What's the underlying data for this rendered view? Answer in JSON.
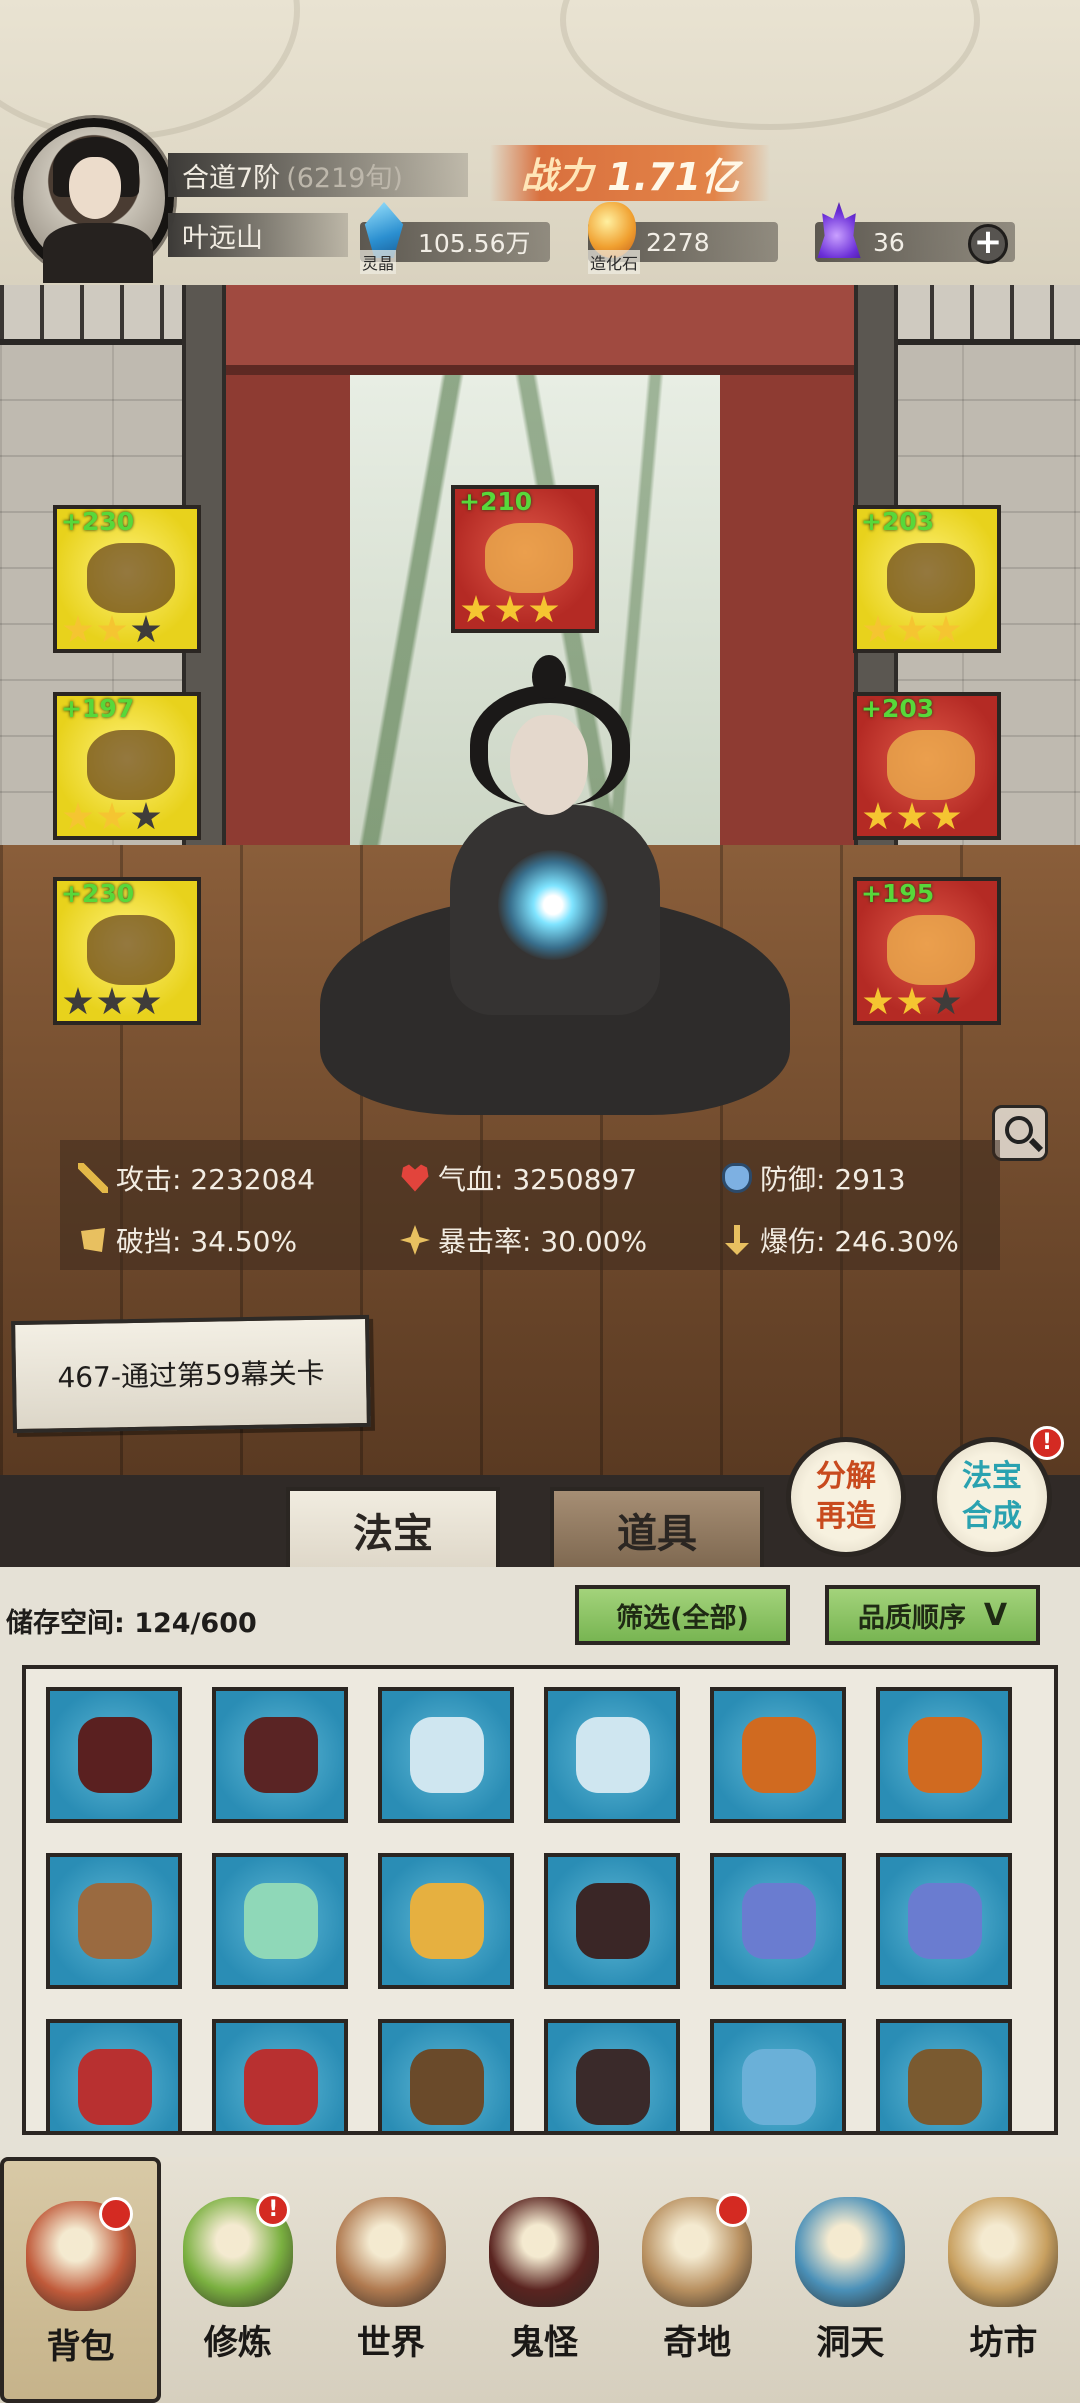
{
  "header": {
    "realm": "合道7阶",
    "realm_sub": "(6219旬)",
    "player_name": "叶远山",
    "combat_power_label": "战力",
    "combat_power_value": "1.71亿",
    "resources": [
      {
        "caption": "灵晶",
        "value": "105.56万",
        "icon": "spirit-crystal-icon"
      },
      {
        "caption": "造化石",
        "value": "2278",
        "icon": "creation-stone-icon"
      },
      {
        "caption": "",
        "value": "36",
        "icon": "purple-flame-icon"
      }
    ],
    "add_label": "+"
  },
  "equipment": [
    {
      "slot": "weapon",
      "bonus": "+230",
      "stars": 2,
      "color": "yellow"
    },
    {
      "slot": "crown",
      "bonus": "+210",
      "stars": 3,
      "color": "red"
    },
    {
      "slot": "headband",
      "bonus": "+203",
      "stars": 3,
      "color": "yellow"
    },
    {
      "slot": "robe",
      "bonus": "+197",
      "stars": 2,
      "color": "yellow"
    },
    {
      "slot": "necklace",
      "bonus": "+203",
      "stars": 3,
      "color": "red"
    },
    {
      "slot": "boots",
      "bonus": "+230",
      "stars": 0,
      "color": "yellow"
    },
    {
      "slot": "ring",
      "bonus": "+195",
      "stars": 2,
      "color": "red"
    }
  ],
  "stats": {
    "attack": "攻击: 2232084",
    "hp": "气血: 3250897",
    "defense": "防御: 2913",
    "break_block": "破挡: 34.50%",
    "crit_rate": "暴击率: 30.00%",
    "crit_damage": "爆伤: 246.30%"
  },
  "quest": "467-通过第59幕关卡",
  "tabs": {
    "treasure": "法宝",
    "items": "道具"
  },
  "round_buttons": {
    "decompose": "分解\n再造",
    "compose": "法宝\n合成",
    "badge": "!"
  },
  "inventory": {
    "storage": "储存空间: 124/600",
    "filter_label": "筛选(全部)",
    "sort_label": "品质顺序",
    "sort_chevron": "V",
    "items": [
      {
        "icon": "dark-claw-icon",
        "color": "#5a2020"
      },
      {
        "icon": "spiked-wheel-icon",
        "color": "#5a2424"
      },
      {
        "icon": "ice-sword-icon",
        "color": "#cfe6f0"
      },
      {
        "icon": "ice-sword-icon",
        "color": "#cfe6f0"
      },
      {
        "icon": "flame-axe-icon",
        "color": "#d06a20"
      },
      {
        "icon": "flame-axe-icon",
        "color": "#d06a20"
      },
      {
        "icon": "bronze-staff-icon",
        "color": "#9a6a40"
      },
      {
        "icon": "jade-mirror-icon",
        "color": "#8fd8b8"
      },
      {
        "icon": "golden-beast-icon",
        "color": "#e6b040"
      },
      {
        "icon": "dark-robe-icon",
        "color": "#3a2626"
      },
      {
        "icon": "blue-fish-icon",
        "color": "#6a7cd0"
      },
      {
        "icon": "blue-fish-icon",
        "color": "#6a7cd0"
      },
      {
        "icon": "demon-mask-icon",
        "color": "#b83030"
      },
      {
        "icon": "demon-mask-icon",
        "color": "#b83030"
      },
      {
        "icon": "leather-armor-icon",
        "color": "#6a4a2a"
      },
      {
        "icon": "crimson-gauntlet-icon",
        "color": "#3a2a2a"
      },
      {
        "icon": "crystal-dragon-icon",
        "color": "#6ab0d8"
      },
      {
        "icon": "wooden-horn-icon",
        "color": "#7a5a30"
      }
    ]
  },
  "nav": [
    {
      "label": "背包",
      "icon": "bag-icon",
      "color": "#c05a3a",
      "badge": ""
    },
    {
      "label": "修炼",
      "icon": "lotus-icon",
      "color": "#7ab040",
      "badge": "!"
    },
    {
      "label": "世界",
      "icon": "scroll-map-icon",
      "color": "#b07a50",
      "badge": ""
    },
    {
      "label": "鬼怪",
      "icon": "demon-egg-icon",
      "color": "#5a2420",
      "badge": ""
    },
    {
      "label": "奇地",
      "icon": "pagoda-icon",
      "color": "#b89060",
      "badge": ""
    },
    {
      "label": "洞天",
      "icon": "portal-icon",
      "color": "#4a90b8",
      "badge": ""
    },
    {
      "label": "坊市",
      "icon": "market-stall-icon",
      "color": "#c8a060",
      "badge": ""
    }
  ]
}
